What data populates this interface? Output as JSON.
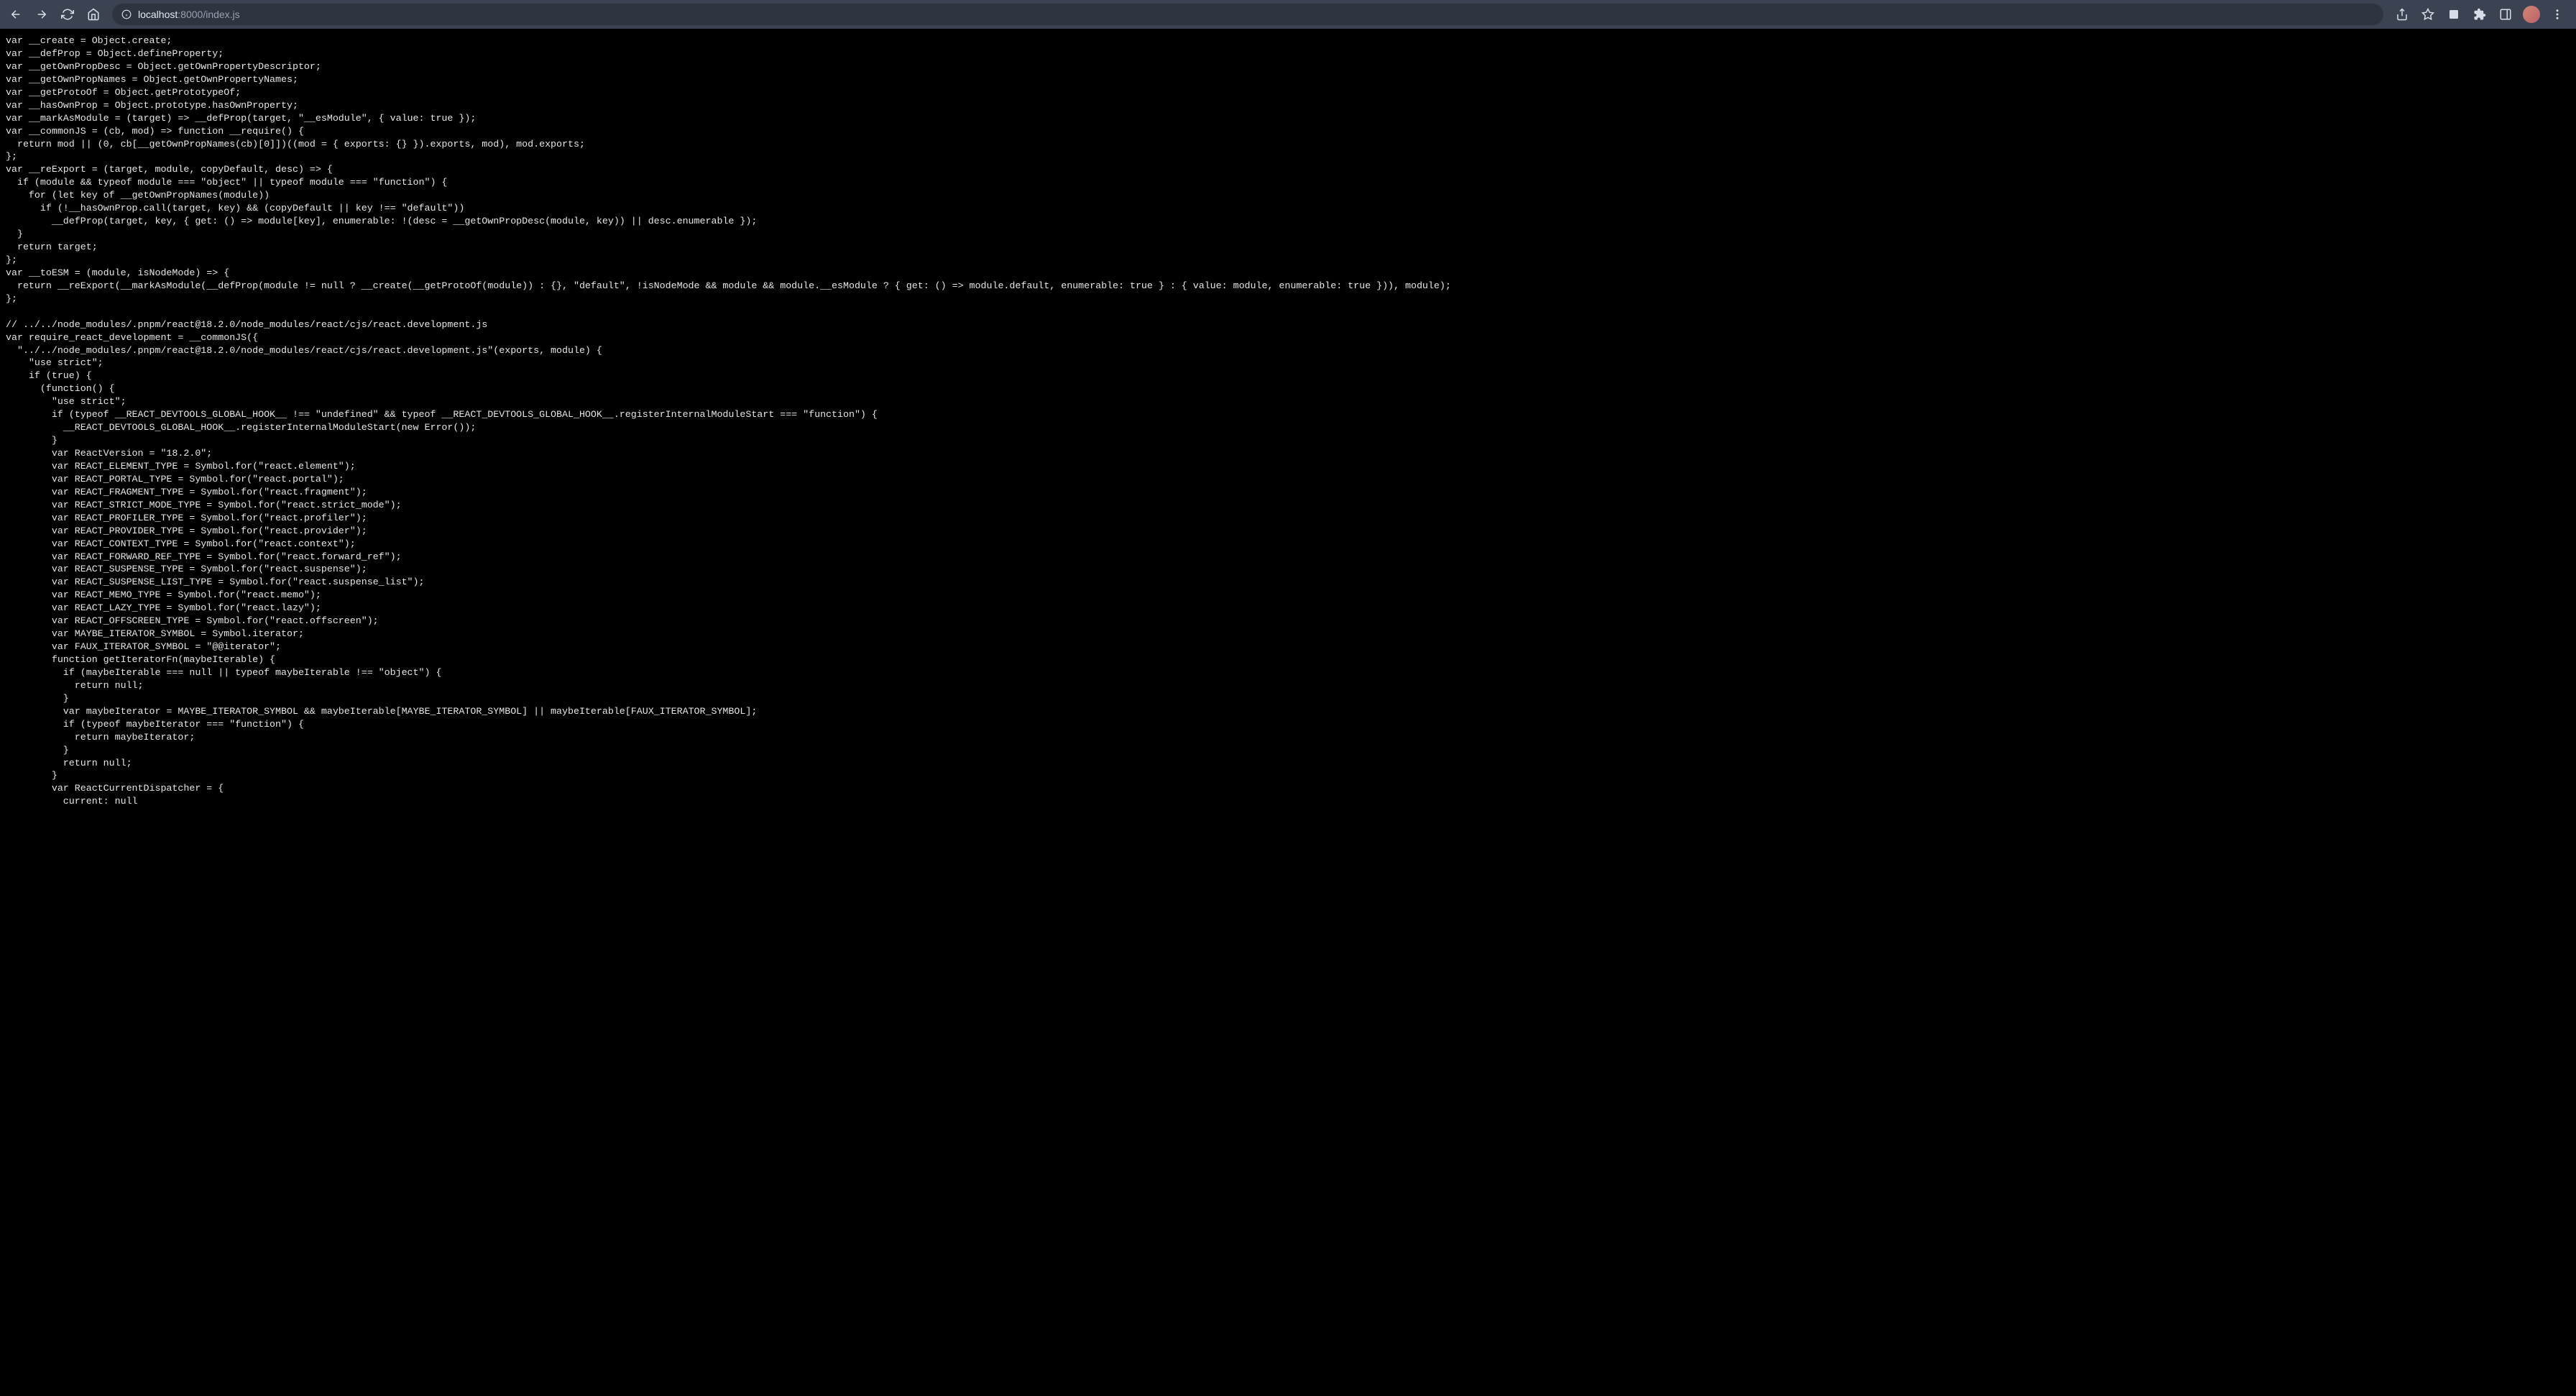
{
  "browser": {
    "url_host": "localhost",
    "url_port": ":8000",
    "url_path": "/index.js"
  },
  "source_code": "var __create = Object.create;\nvar __defProp = Object.defineProperty;\nvar __getOwnPropDesc = Object.getOwnPropertyDescriptor;\nvar __getOwnPropNames = Object.getOwnPropertyNames;\nvar __getProtoOf = Object.getPrototypeOf;\nvar __hasOwnProp = Object.prototype.hasOwnProperty;\nvar __markAsModule = (target) => __defProp(target, \"__esModule\", { value: true });\nvar __commonJS = (cb, mod) => function __require() {\n  return mod || (0, cb[__getOwnPropNames(cb)[0]])((mod = { exports: {} }).exports, mod), mod.exports;\n};\nvar __reExport = (target, module, copyDefault, desc) => {\n  if (module && typeof module === \"object\" || typeof module === \"function\") {\n    for (let key of __getOwnPropNames(module))\n      if (!__hasOwnProp.call(target, key) && (copyDefault || key !== \"default\"))\n        __defProp(target, key, { get: () => module[key], enumerable: !(desc = __getOwnPropDesc(module, key)) || desc.enumerable });\n  }\n  return target;\n};\nvar __toESM = (module, isNodeMode) => {\n  return __reExport(__markAsModule(__defProp(module != null ? __create(__getProtoOf(module)) : {}, \"default\", !isNodeMode && module && module.__esModule ? { get: () => module.default, enumerable: true } : { value: module, enumerable: true })), module);\n};\n\n// ../../node_modules/.pnpm/react@18.2.0/node_modules/react/cjs/react.development.js\nvar require_react_development = __commonJS({\n  \"../../node_modules/.pnpm/react@18.2.0/node_modules/react/cjs/react.development.js\"(exports, module) {\n    \"use strict\";\n    if (true) {\n      (function() {\n        \"use strict\";\n        if (typeof __REACT_DEVTOOLS_GLOBAL_HOOK__ !== \"undefined\" && typeof __REACT_DEVTOOLS_GLOBAL_HOOK__.registerInternalModuleStart === \"function\") {\n          __REACT_DEVTOOLS_GLOBAL_HOOK__.registerInternalModuleStart(new Error());\n        }\n        var ReactVersion = \"18.2.0\";\n        var REACT_ELEMENT_TYPE = Symbol.for(\"react.element\");\n        var REACT_PORTAL_TYPE = Symbol.for(\"react.portal\");\n        var REACT_FRAGMENT_TYPE = Symbol.for(\"react.fragment\");\n        var REACT_STRICT_MODE_TYPE = Symbol.for(\"react.strict_mode\");\n        var REACT_PROFILER_TYPE = Symbol.for(\"react.profiler\");\n        var REACT_PROVIDER_TYPE = Symbol.for(\"react.provider\");\n        var REACT_CONTEXT_TYPE = Symbol.for(\"react.context\");\n        var REACT_FORWARD_REF_TYPE = Symbol.for(\"react.forward_ref\");\n        var REACT_SUSPENSE_TYPE = Symbol.for(\"react.suspense\");\n        var REACT_SUSPENSE_LIST_TYPE = Symbol.for(\"react.suspense_list\");\n        var REACT_MEMO_TYPE = Symbol.for(\"react.memo\");\n        var REACT_LAZY_TYPE = Symbol.for(\"react.lazy\");\n        var REACT_OFFSCREEN_TYPE = Symbol.for(\"react.offscreen\");\n        var MAYBE_ITERATOR_SYMBOL = Symbol.iterator;\n        var FAUX_ITERATOR_SYMBOL = \"@@iterator\";\n        function getIteratorFn(maybeIterable) {\n          if (maybeIterable === null || typeof maybeIterable !== \"object\") {\n            return null;\n          }\n          var maybeIterator = MAYBE_ITERATOR_SYMBOL && maybeIterable[MAYBE_ITERATOR_SYMBOL] || maybeIterable[FAUX_ITERATOR_SYMBOL];\n          if (typeof maybeIterator === \"function\") {\n            return maybeIterator;\n          }\n          return null;\n        }\n        var ReactCurrentDispatcher = {\n          current: null"
}
